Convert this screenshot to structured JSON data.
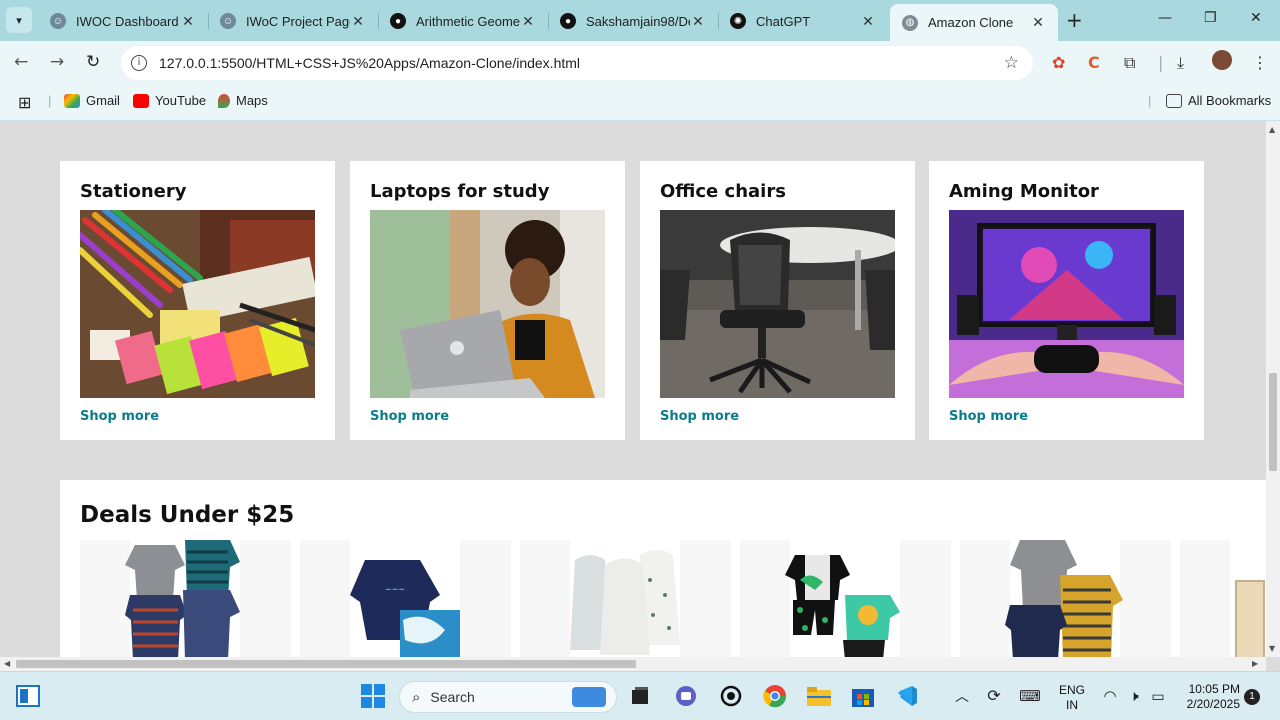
{
  "browser": {
    "tabs": [
      {
        "title": "IWOC Dashboard",
        "active": false
      },
      {
        "title": "IWoC Project Page",
        "active": false
      },
      {
        "title": "Arithmetic Geometry",
        "active": false
      },
      {
        "title": "Sakshamjain98/De",
        "active": false
      },
      {
        "title": "ChatGPT",
        "active": false
      },
      {
        "title": "Amazon Clone",
        "active": true
      }
    ],
    "url": "127.0.0.1:5500/HTML+CSS+JS%20Apps/Amazon-Clone/index.html",
    "bookmarks": [
      {
        "label": "Gmail"
      },
      {
        "label": "YouTube"
      },
      {
        "label": "Maps"
      }
    ],
    "all_bookmarks": "All Bookmarks"
  },
  "page": {
    "cards": [
      {
        "title": "Stationery",
        "link": "Shop more"
      },
      {
        "title": "Laptops for study",
        "link": "Shop more"
      },
      {
        "title": "Office chairs",
        "link": "Shop more"
      },
      {
        "title": "Aming Monitor",
        "link": "Shop more"
      }
    ],
    "deals": {
      "title": "Deals Under $25"
    }
  },
  "taskbar": {
    "search_label": "Search",
    "lang_line1": "ENG",
    "lang_line2": "IN",
    "time": "10:05 PM",
    "date": "2/20/2025",
    "notification_count": "1"
  },
  "colors": {
    "accent": "#0a7d8c",
    "tabstrip": "#a9d8df",
    "toolbar": "#eaf6f8"
  }
}
